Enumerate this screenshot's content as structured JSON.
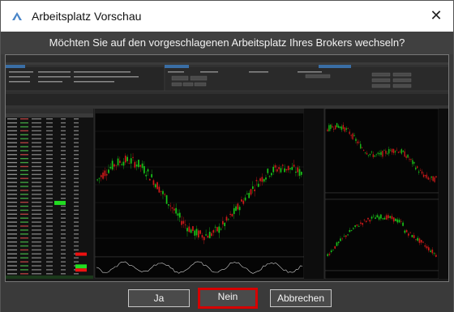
{
  "window": {
    "title": "Arbeitsplatz Vorschau",
    "close_glyph": "✕",
    "icon": "brokerage-app-icon"
  },
  "question": "Möchten Sie auf den vorgeschlagenen Arbeitsplatz Ihres Brokers wechseln?",
  "buttons": {
    "yes": "Ja",
    "no": "Nein",
    "cancel": "Abbrechen"
  },
  "colors": {
    "highlight_border": "#d60000",
    "bull_candle": "#19c419",
    "bear_candle": "#d01a1a",
    "watchlist_green": "#22dd22",
    "watchlist_red": "#ee1111"
  }
}
